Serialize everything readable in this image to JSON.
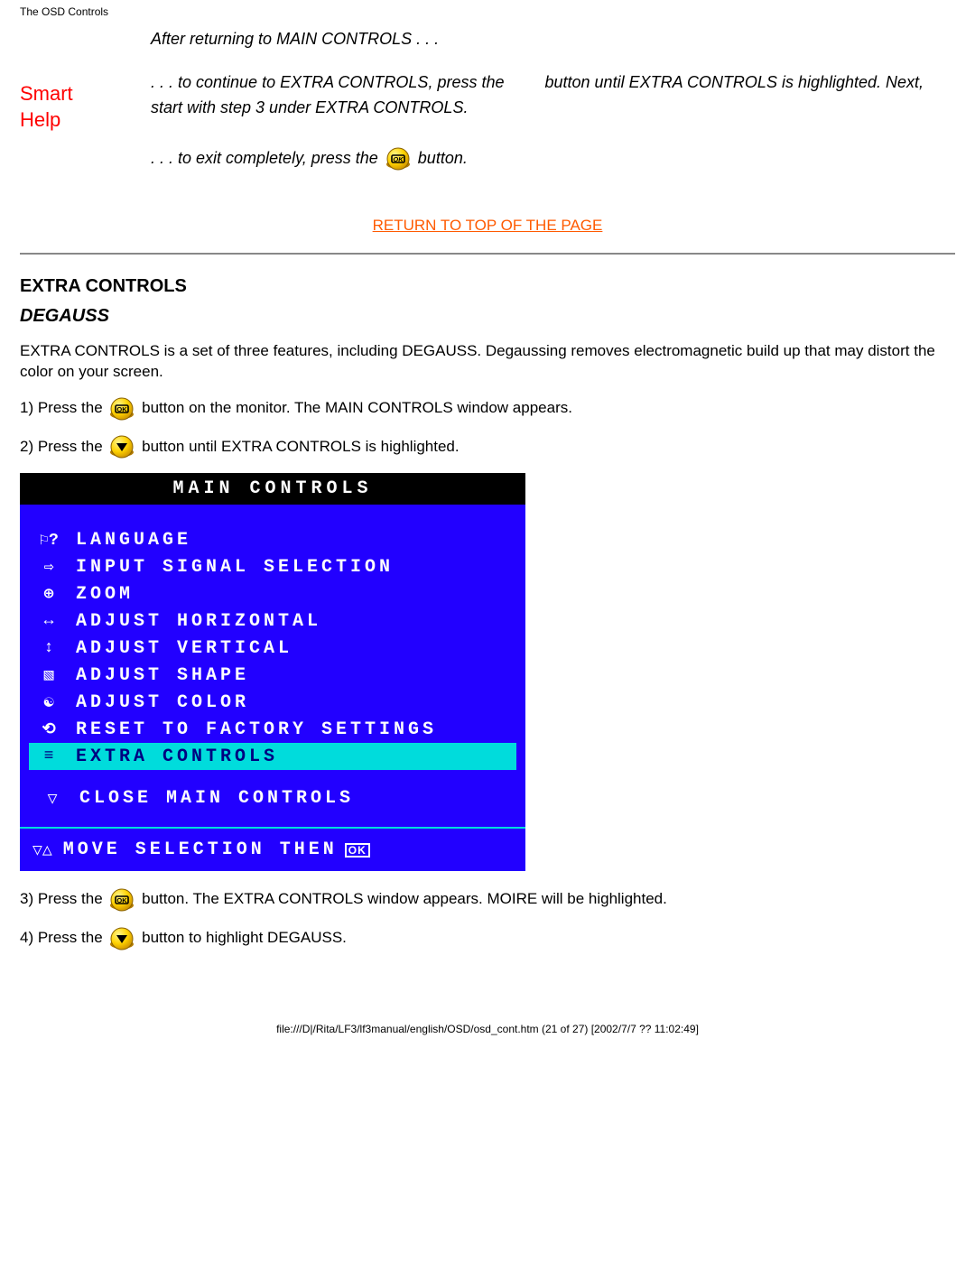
{
  "pageHeader": "The OSD Controls",
  "smartHelp": {
    "line1": "Smart",
    "line2": "Help"
  },
  "intro": {
    "afterReturn": "After returning to MAIN CONTROLS . . .",
    "continuePrefix": ". . . to continue to EXTRA CONTROLS, press the",
    "continueMid": "button until EXTRA",
    "continueSuffix": "CONTROLS is highlighted. Next, start with step 3 under EXTRA CONTROLS.",
    "exitPrefix": ". . . to exit completely, press the ",
    "exitSuffix": " button."
  },
  "returnTop": "RETURN TO TOP OF THE PAGE",
  "section": {
    "title": "EXTRA CONTROLS",
    "subtitle": "DEGAUSS"
  },
  "degaussDesc": "EXTRA CONTROLS is a set of three features, including DEGAUSS. Degaussing removes electromagnetic build up that may distort the color on your screen.",
  "steps": {
    "s1a": "1) Press the ",
    "s1b": " button on the monitor. The MAIN CONTROLS window appears.",
    "s2a": "2) Press the ",
    "s2b": " button until EXTRA CONTROLS is highlighted.",
    "s3a": "3) Press the ",
    "s3b": " button. The EXTRA CONTROLS window appears. MOIRE will be highlighted.",
    "s4a": "4) Press the ",
    "s4b": " button to highlight DEGAUSS."
  },
  "osd": {
    "title": "MAIN CONTROLS",
    "items": [
      {
        "icon": "lang",
        "label": "LANGUAGE"
      },
      {
        "icon": "input",
        "label": "INPUT SIGNAL SELECTION"
      },
      {
        "icon": "zoom",
        "label": "ZOOM"
      },
      {
        "icon": "horiz",
        "label": "ADJUST HORIZONTAL"
      },
      {
        "icon": "vert",
        "label": "ADJUST VERTICAL"
      },
      {
        "icon": "shape",
        "label": "ADJUST SHAPE"
      },
      {
        "icon": "color",
        "label": "ADJUST COLOR"
      },
      {
        "icon": "reset",
        "label": "RESET TO FACTORY SETTINGS"
      },
      {
        "icon": "extra",
        "label": "EXTRA CONTROLS",
        "highlight": true
      }
    ],
    "close": "CLOSE MAIN CONTROLS",
    "footer": "MOVE SELECTION THEN",
    "okLabel": "OK"
  },
  "fileFooter": "file:///D|/Rita/LF3/lf3manual/english/OSD/osd_cont.htm (21 of 27) [2002/7/7 ?? 11:02:49]"
}
